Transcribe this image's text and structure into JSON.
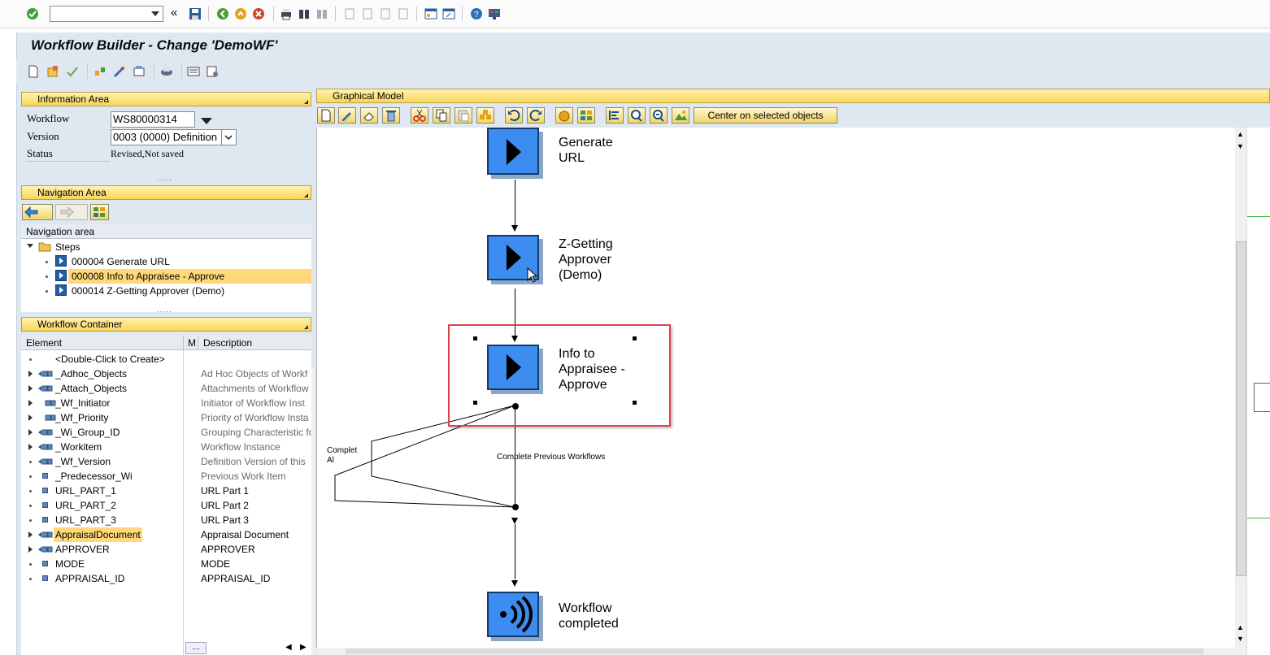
{
  "window": {
    "title": "Workflow Builder - Change 'DemoWF'"
  },
  "system_toolbar": {
    "command_field_value": "",
    "icons": [
      "enter-icon",
      "save-icon",
      "back-icon",
      "exit-icon",
      "cancel-icon",
      "print-icon",
      "find-icon",
      "find-next-icon",
      "first-page-icon",
      "previous-page-icon",
      "next-page-icon",
      "last-page-icon",
      "new-session-icon",
      "create-shortcut-icon",
      "help-icon",
      "customize-layout-icon"
    ]
  },
  "information_area": {
    "header": "Information Area",
    "workflow_label": "Workflow",
    "workflow_value": "WS80000314",
    "version_label": "Version",
    "version_value": "0003 (0000) Definition",
    "status_label": "Status",
    "status_value": "Revised,Not saved"
  },
  "navigation_area": {
    "header": "Navigation Area",
    "tree_header": "Navigation area",
    "root": "Steps",
    "items": [
      {
        "label": "000004 Generate URL",
        "selected": false
      },
      {
        "label": "000008 Info to Appraisee - Approve",
        "selected": true
      },
      {
        "label": "000014 Z-Getting Approver (Demo)",
        "selected": false
      }
    ]
  },
  "workflow_container": {
    "header": "Workflow Container",
    "col_element": "Element",
    "col_m": "M",
    "col_description": "Description",
    "rows": [
      {
        "element": "<Double-Click to Create>",
        "description": "",
        "type": "none",
        "expandable": false
      },
      {
        "element": "_Adhoc_Objects",
        "description": "Ad Hoc Objects of Workf",
        "type": "object",
        "expandable": true
      },
      {
        "element": "_Attach_Objects",
        "description": "Attachments of Workflow",
        "type": "object",
        "expandable": true
      },
      {
        "element": "_Wf_Initiator",
        "description": "Initiator of Workflow Inst",
        "type": "object-small",
        "expandable": true
      },
      {
        "element": "_Wf_Priority",
        "description": "Priority of Workflow Insta",
        "type": "object-small",
        "expandable": true
      },
      {
        "element": "_Wi_Group_ID",
        "description": "Grouping Characteristic fo",
        "type": "object",
        "expandable": true
      },
      {
        "element": "_Workitem",
        "description": "Workflow Instance",
        "type": "object",
        "expandable": true
      },
      {
        "element": "_Wf_Version",
        "description": "Definition Version of this",
        "type": "object",
        "expandable": false
      },
      {
        "element": "_Predecessor_Wi",
        "description": "Previous Work Item",
        "type": "field",
        "expandable": false
      },
      {
        "element": "URL_PART_1",
        "description": "URL Part 1",
        "type": "field",
        "expandable": false
      },
      {
        "element": "URL_PART_2",
        "description": "URL Part 2",
        "type": "field",
        "expandable": false
      },
      {
        "element": "URL_PART_3",
        "description": "URL Part 3",
        "type": "field",
        "expandable": false
      },
      {
        "element": "AppraisalDocument",
        "description": "Appraisal Document",
        "type": "object",
        "expandable": true,
        "highlight": true
      },
      {
        "element": "APPROVER",
        "description": "APPROVER",
        "type": "object",
        "expandable": true
      },
      {
        "element": "MODE",
        "description": "MODE",
        "type": "field",
        "expandable": false
      },
      {
        "element": "APPRAISAL_ID",
        "description": "APPRAISAL_ID",
        "type": "field",
        "expandable": false
      }
    ]
  },
  "graphical_model": {
    "header": "Graphical Model",
    "center_button": "Center on selected objects",
    "nodes": [
      {
        "label_line1": "Generate",
        "label_line2": "URL",
        "label_line3": ""
      },
      {
        "label_line1": "Z-Getting",
        "label_line2": "Approver",
        "label_line3": "(Demo)"
      },
      {
        "label_line1": "Info to",
        "label_line2": "Appraisee -",
        "label_line3": "Approve"
      },
      {
        "label_line1": "Workflow",
        "label_line2": "completed",
        "label_line3": ""
      }
    ],
    "outcome_label": "Complete Previous Workflows",
    "side_label_line1": "Complet",
    "side_label_line2": "Al",
    "accent": "#3d8cf0",
    "highlight_border": "#d9434a"
  },
  "colors": {
    "panel_header": "#f7d65a",
    "frame_bg": "#dfe8f1",
    "selection": "#ffd87a"
  }
}
